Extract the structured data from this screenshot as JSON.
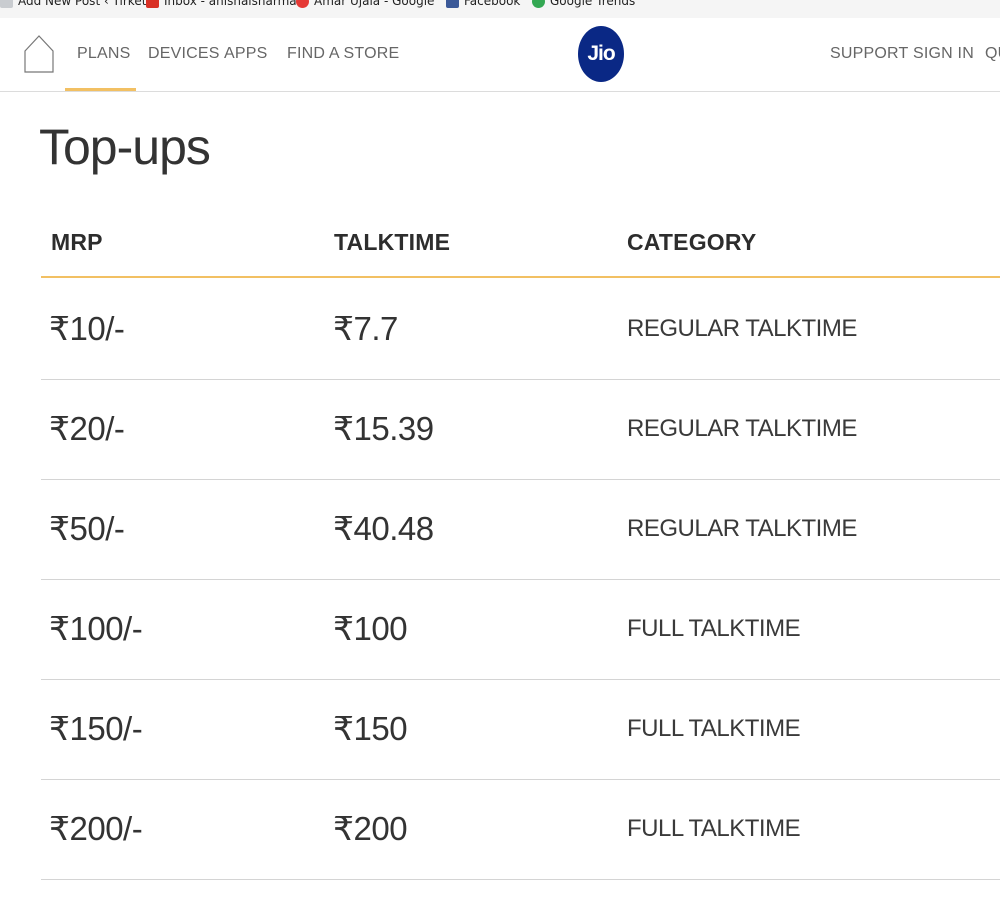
{
  "bookmarks": [
    {
      "label": "Add New Post ‹ Tirket",
      "icon": "document-icon",
      "color": "#9aa0a6"
    },
    {
      "label": "Inbox - anishaisharma",
      "icon": "gmail-icon",
      "color": "#d93025"
    },
    {
      "label": "Amar Ujala - Google",
      "icon": "amar-ujala-icon",
      "color": "#e53935"
    },
    {
      "label": "Facebook",
      "icon": "facebook-icon",
      "color": "#3b5998"
    },
    {
      "label": "Google Trends",
      "icon": "google-trends-icon",
      "color": "#34a853"
    }
  ],
  "nav": {
    "left_links": [
      "PLANS",
      "DEVICES",
      "APPS",
      "FIND A STORE"
    ],
    "right_links": [
      "SUPPORT",
      "SIGN IN",
      "QU"
    ],
    "active_link": "PLANS",
    "logo_text": "Jio",
    "logo_color": "#0a2885",
    "accent_color": "#f2c063"
  },
  "page": {
    "title": "Top-ups"
  },
  "table": {
    "columns": [
      "MRP",
      "TALKTIME",
      "CATEGORY"
    ],
    "rows": [
      {
        "mrp": "₹10/-",
        "talktime": "₹7.7",
        "category": "REGULAR TALKTIME"
      },
      {
        "mrp": "₹20/-",
        "talktime": "₹15.39",
        "category": "REGULAR TALKTIME"
      },
      {
        "mrp": "₹50/-",
        "talktime": "₹40.48",
        "category": "REGULAR TALKTIME"
      },
      {
        "mrp": "₹100/-",
        "talktime": "₹100",
        "category": "FULL TALKTIME"
      },
      {
        "mrp": "₹150/-",
        "talktime": "₹150",
        "category": "FULL TALKTIME"
      },
      {
        "mrp": "₹200/-",
        "talktime": "₹200",
        "category": "FULL TALKTIME"
      }
    ]
  }
}
